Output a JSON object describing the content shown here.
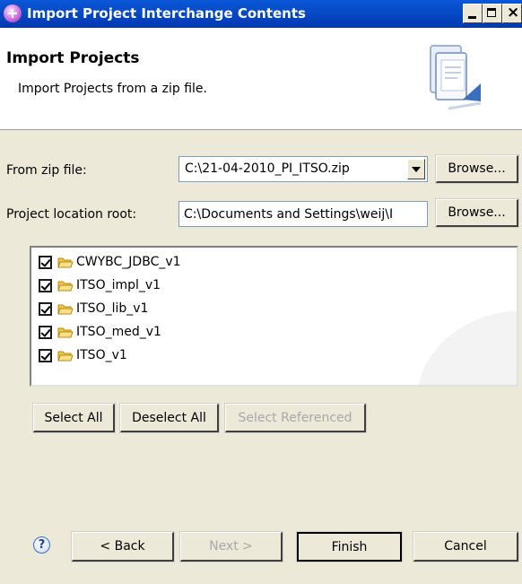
{
  "window": {
    "title": "Import Project Interchange Contents",
    "close_glyph": "×"
  },
  "header": {
    "title": "Import Projects",
    "description": "Import Projects from a zip file."
  },
  "form": {
    "zip_label": "From zip file:",
    "zip_value": "C:\\21-04-2010_PI_ITSO.zip",
    "root_label": "Project location root:",
    "root_value": "C:\\Documents and Settings\\weij\\I",
    "browse_label": "Browse..."
  },
  "projects": [
    {
      "name": "CWYBC_JDBC_v1",
      "checked": true
    },
    {
      "name": "ITSO_impl_v1",
      "checked": true
    },
    {
      "name": "ITSO_lib_v1",
      "checked": true
    },
    {
      "name": "ITSO_med_v1",
      "checked": true
    },
    {
      "name": "ITSO_v1",
      "checked": true
    }
  ],
  "selection_buttons": {
    "select_all": "Select All",
    "deselect_all": "Deselect All",
    "select_referenced": "Select Referenced"
  },
  "footer": {
    "help_glyph": "?",
    "back": "< Back",
    "next": "Next >",
    "finish": "Finish",
    "cancel": "Cancel"
  },
  "colors": {
    "titlebar": "#0a58d8",
    "dialog_bg": "#ece9d8",
    "folder": "#f4c542"
  },
  "icons": [
    "app-icon",
    "minimize-icon",
    "maximize-icon",
    "close-icon",
    "wizard-banner-icon",
    "folder-icon",
    "checkbox-checked-icon",
    "help-icon"
  ]
}
